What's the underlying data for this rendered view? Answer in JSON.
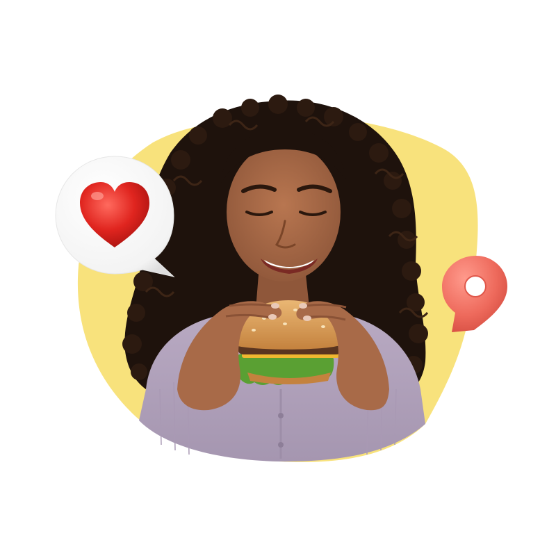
{
  "scene": {
    "description_label": "",
    "colors": {
      "background": "#ffffff",
      "blob": "#f8e27c",
      "hair": "#1e120c",
      "skin": "#a86a48",
      "skin_shadow": "#8a5236",
      "sweater": "#b5a6bf",
      "sweater_shadow": "#9d8ea8",
      "bun": "#d89a52",
      "bun_top": "#e4ad66",
      "lettuce": "#5aa033",
      "patty": "#5a3520",
      "cheese": "#f0b830",
      "heart": "#e0251f",
      "bubble": "#ffffff",
      "pin": "#ee6a5c"
    },
    "icons": {
      "heart_bubble": "heart-speech-bubble-icon",
      "location_pin": "location-pin-icon"
    }
  }
}
